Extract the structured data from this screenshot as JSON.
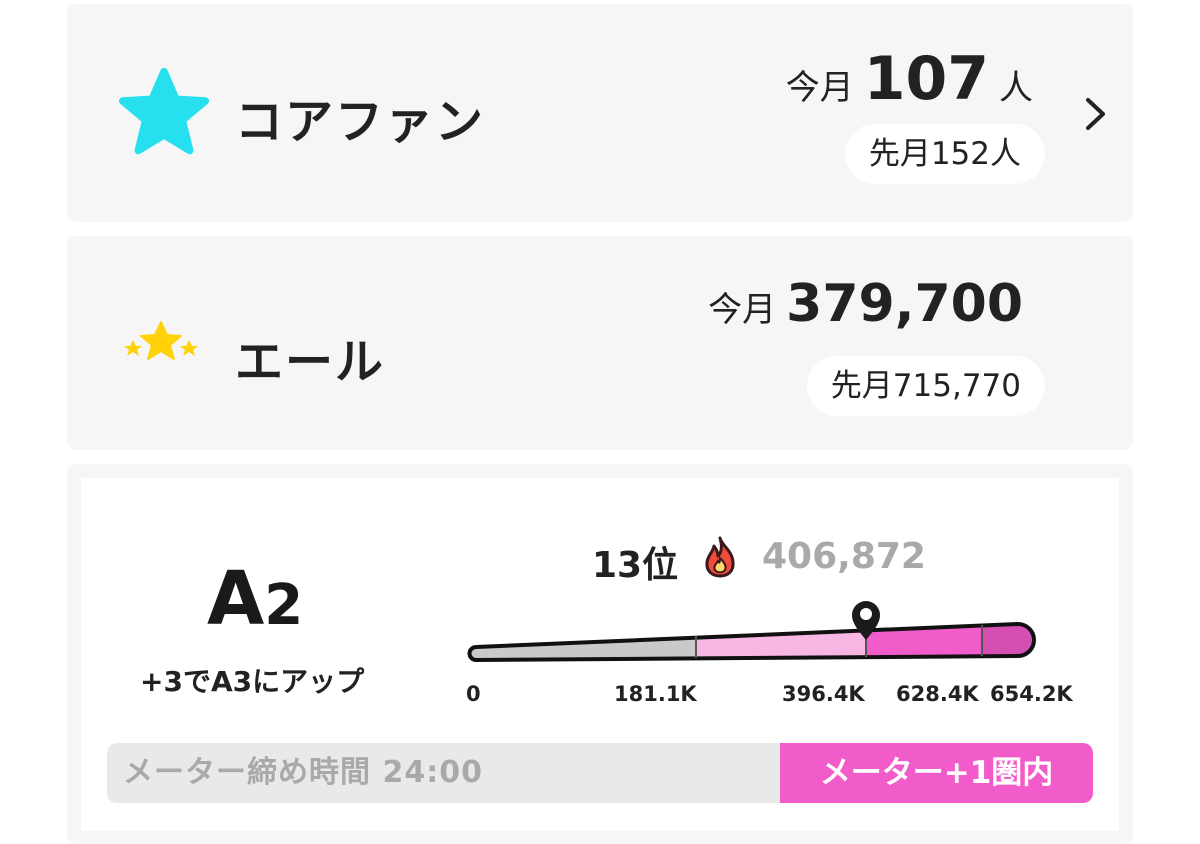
{
  "core_fan": {
    "icon": "star-icon",
    "icon_color": "#26e0f0",
    "title": "コアファン",
    "this_month_prefix": "今月",
    "this_month_value": "107",
    "this_month_unit": "人",
    "last_month": "先月152人"
  },
  "yell": {
    "icon": "three-stars-icon",
    "icon_color": "#ffd20a",
    "title": "エール",
    "this_month_prefix": "今月",
    "this_month_value": "379,700",
    "last_month": "先月715,770"
  },
  "rank": {
    "tier_letter": "A",
    "tier_number": "2",
    "up_note": "+3でA3にアップ",
    "position": "13位",
    "flame_icon": "flame-icon",
    "score": "406,872",
    "meter_ticks": [
      "0",
      "181.1K",
      "396.4K",
      "628.4K",
      "654.2K"
    ],
    "meter_fill_colors": {
      "gray": "#c9c9c9",
      "light_pink": "#f8b6e3",
      "pink": "#f25cca",
      "dark_pink": "#d44fb1"
    }
  },
  "footer": {
    "deadline": "メーター締め時間 24:00",
    "badge": "メーター+1圏内",
    "badge_color": "#f25cca"
  }
}
